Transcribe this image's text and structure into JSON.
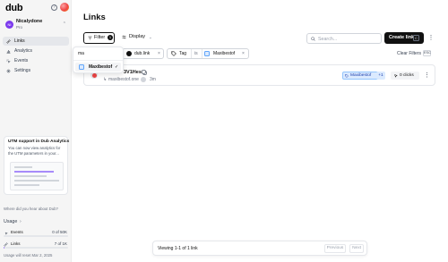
{
  "app": {
    "logo": "dub"
  },
  "sidebar": {
    "workspace": {
      "initials": "NI",
      "name": "Nicalydone",
      "plan": "Pro"
    },
    "items": [
      {
        "label": "Links",
        "active": true
      },
      {
        "label": "Analytics",
        "active": false
      },
      {
        "label": "Events",
        "active": false
      },
      {
        "label": "Settings",
        "active": false
      }
    ],
    "promo": {
      "title": "UTM support in Dub Analytics",
      "description": "You can now view analytics for the UTM parameters in your..."
    },
    "hear_about": "Where did you hear about Dub?",
    "usage": {
      "title": "Usage",
      "rows": [
        {
          "label": "Events",
          "value": "0 of 50K",
          "fraction": 0.0
        },
        {
          "label": "Links",
          "value": "7 of 1K",
          "fraction": 0.007
        }
      ],
      "reset_note": "Usage will reset Mar 2, 2025"
    }
  },
  "main": {
    "title": "Links",
    "toolbar": {
      "filter_label": "Filter",
      "filter_count": "1",
      "display_label": "Display",
      "search_placeholder": "Search...",
      "create_label": "Create link",
      "create_key": "C"
    },
    "filters": {
      "domain": "dub.link",
      "tag_label": "Tag",
      "tag_operator": "is",
      "tag_value": "Maxibestof",
      "clear_label": "Clear Filters",
      "clear_key": "ESC"
    },
    "dropdown": {
      "query": "ma",
      "options": [
        {
          "label": "Maxibestof",
          "selected": true
        }
      ]
    },
    "links": [
      {
        "short": "3V1Hes",
        "destination": "maxibestof.one",
        "time": "3m",
        "tag": "Maxibestof",
        "tag_more": "+1",
        "clicks": "0 clicks"
      }
    ],
    "pagination": {
      "text": "Viewing 1-1 of 1 link",
      "prev": "Previous",
      "next": "Next"
    }
  },
  "colors": {
    "accent": "#111111",
    "tag_bg": "#dbeafe",
    "tag_text": "#1e40af",
    "usage_bar": "#a78bfa"
  }
}
